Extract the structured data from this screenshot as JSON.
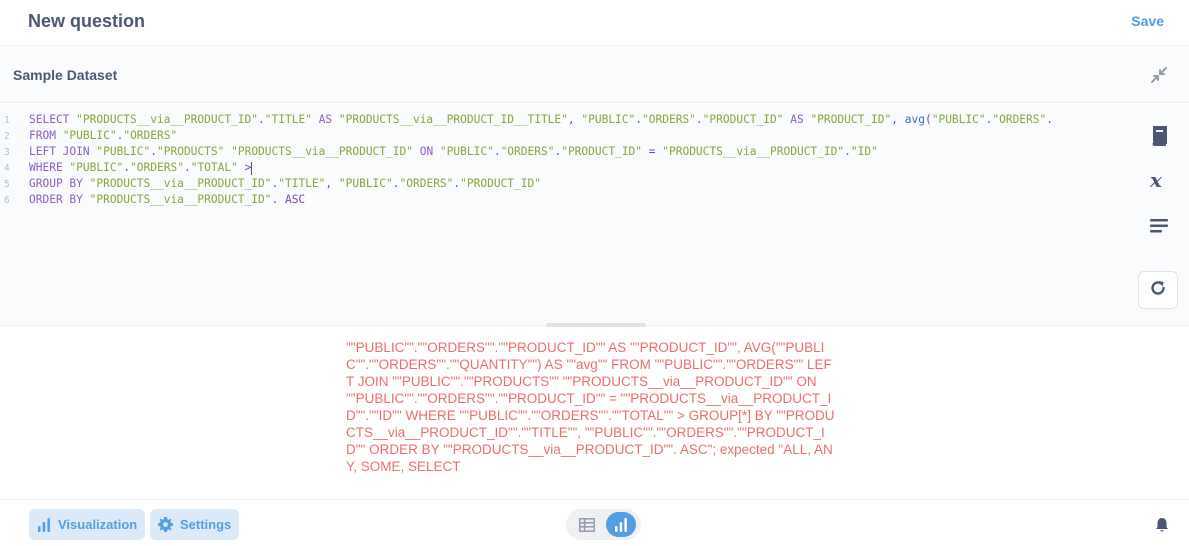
{
  "header": {
    "title": "New question",
    "save_label": "Save"
  },
  "dataset": {
    "name": "Sample Dataset",
    "collapse_icon": "collapse-icon"
  },
  "editor": {
    "lines": [
      {
        "num": "1",
        "tokens": [
          {
            "t": "SELECT ",
            "c": "kw"
          },
          {
            "t": "\"PRODUCTS__via__PRODUCT_ID\"",
            "c": "str"
          },
          {
            "t": ".",
            "c": "plain"
          },
          {
            "t": "\"TITLE\"",
            "c": "str"
          },
          {
            "t": " AS ",
            "c": "kw"
          },
          {
            "t": "\"PRODUCTS__via__PRODUCT_ID__TITLE\"",
            "c": "str"
          },
          {
            "t": ", ",
            "c": "plain"
          },
          {
            "t": "\"PUBLIC\"",
            "c": "str"
          },
          {
            "t": ".",
            "c": "plain"
          },
          {
            "t": "\"ORDERS\"",
            "c": "str"
          },
          {
            "t": ".",
            "c": "plain"
          },
          {
            "t": "\"PRODUCT_ID\"",
            "c": "str"
          },
          {
            "t": " AS ",
            "c": "kw"
          },
          {
            "t": "\"PRODUCT_ID\"",
            "c": "str"
          },
          {
            "t": ", ",
            "c": "plain"
          },
          {
            "t": "avg",
            "c": "fn"
          },
          {
            "t": "(",
            "c": "plain"
          },
          {
            "t": "\"PUBLIC\"",
            "c": "str"
          },
          {
            "t": ".",
            "c": "plain"
          },
          {
            "t": "\"ORDERS\"",
            "c": "str"
          },
          {
            "t": ".",
            "c": "plain"
          }
        ]
      },
      {
        "num": "2",
        "tokens": [
          {
            "t": "FROM ",
            "c": "kw"
          },
          {
            "t": "\"PUBLIC\"",
            "c": "str"
          },
          {
            "t": ".",
            "c": "plain"
          },
          {
            "t": "\"ORDERS\"",
            "c": "str"
          }
        ]
      },
      {
        "num": "3",
        "tokens": [
          {
            "t": "LEFT JOIN ",
            "c": "kw"
          },
          {
            "t": "\"PUBLIC\"",
            "c": "str"
          },
          {
            "t": ".",
            "c": "plain"
          },
          {
            "t": "\"PRODUCTS\"",
            "c": "str"
          },
          {
            "t": " ",
            "c": "plain"
          },
          {
            "t": "\"PRODUCTS__via__PRODUCT_ID\"",
            "c": "str"
          },
          {
            "t": " ON ",
            "c": "kw"
          },
          {
            "t": "\"PUBLIC\"",
            "c": "str"
          },
          {
            "t": ".",
            "c": "plain"
          },
          {
            "t": "\"ORDERS\"",
            "c": "str"
          },
          {
            "t": ".",
            "c": "plain"
          },
          {
            "t": "\"PRODUCT_ID\"",
            "c": "str"
          },
          {
            "t": " = ",
            "c": "plain"
          },
          {
            "t": "\"PRODUCTS__via__PRODUCT_ID\"",
            "c": "str"
          },
          {
            "t": ".",
            "c": "plain"
          },
          {
            "t": "\"ID\"",
            "c": "str"
          }
        ]
      },
      {
        "num": "4",
        "tokens": [
          {
            "t": "WHERE ",
            "c": "kw"
          },
          {
            "t": "\"PUBLIC\"",
            "c": "str"
          },
          {
            "t": ".",
            "c": "plain"
          },
          {
            "t": "\"ORDERS\"",
            "c": "str"
          },
          {
            "t": ".",
            "c": "plain"
          },
          {
            "t": "\"TOTAL\"",
            "c": "str"
          },
          {
            "t": " >",
            "c": "plain"
          }
        ],
        "cursor": true
      },
      {
        "num": "5",
        "tokens": [
          {
            "t": "GROUP BY ",
            "c": "kw"
          },
          {
            "t": "\"PRODUCTS__via__PRODUCT_ID\"",
            "c": "str"
          },
          {
            "t": ".",
            "c": "plain"
          },
          {
            "t": "\"TITLE\"",
            "c": "str"
          },
          {
            "t": ", ",
            "c": "plain"
          },
          {
            "t": "\"PUBLIC\"",
            "c": "str"
          },
          {
            "t": ".",
            "c": "plain"
          },
          {
            "t": "\"ORDERS\"",
            "c": "str"
          },
          {
            "t": ".",
            "c": "plain"
          },
          {
            "t": "\"PRODUCT_ID\"",
            "c": "str"
          }
        ]
      },
      {
        "num": "6",
        "tokens": [
          {
            "t": "ORDER BY ",
            "c": "kw"
          },
          {
            "t": "\"PRODUCTS__via__PRODUCT_ID\"",
            "c": "str"
          },
          {
            "t": ". ASC",
            "c": "plain"
          }
        ]
      }
    ]
  },
  "side_tools": [
    "book-icon",
    "variable-icon",
    "snippet-icon",
    "refresh-icon"
  ],
  "results": {
    "error_text": "\"\"PUBLIC\"\".\"\"ORDERS\"\".\"\"PRODUCT_ID\"\" AS \"\"PRODUCT_ID\"\", AVG(\"\"PUBLIC\"\".\"\"ORDERS\"\".\"\"QUANTITY\"\") AS \"\"avg\"\" FROM \"\"PUBLIC\"\".\"\"ORDERS\"\" LEFT JOIN \"\"PUBLIC\"\".\"\"PRODUCTS\"\" \"\"PRODUCTS__via__PRODUCT_ID\"\" ON \"\"PUBLIC\"\".\"\"ORDERS\"\".\"\"PRODUCT_ID\"\" = \"\"PRODUCTS__via__PRODUCT_ID\"\".\"\"ID\"\" WHERE \"\"PUBLIC\"\".\"\"ORDERS\"\".\"\"TOTAL\"\" > GROUP[*] BY \"\"PRODUCTS__via__PRODUCT_ID\"\".\"\"TITLE\"\", \"\"PUBLIC\"\".\"\"ORDERS\"\".\"\"PRODUCT_ID\"\" ORDER BY \"\"PRODUCTS__via__PRODUCT_ID\"\". ASC\"; expected \"ALL, ANY, SOME, SELECT"
  },
  "footer": {
    "visualization_label": "Visualization",
    "settings_label": "Settings",
    "view_toggle": [
      "table-icon",
      "chart-icon"
    ],
    "active_view": "chart",
    "notification_icon": "bell-icon"
  },
  "colors": {
    "accent": "#509ee3",
    "error": "#ed6e6e",
    "keyword": "#8e5ec8",
    "string": "#84a83a",
    "function": "#3b6ec1"
  }
}
